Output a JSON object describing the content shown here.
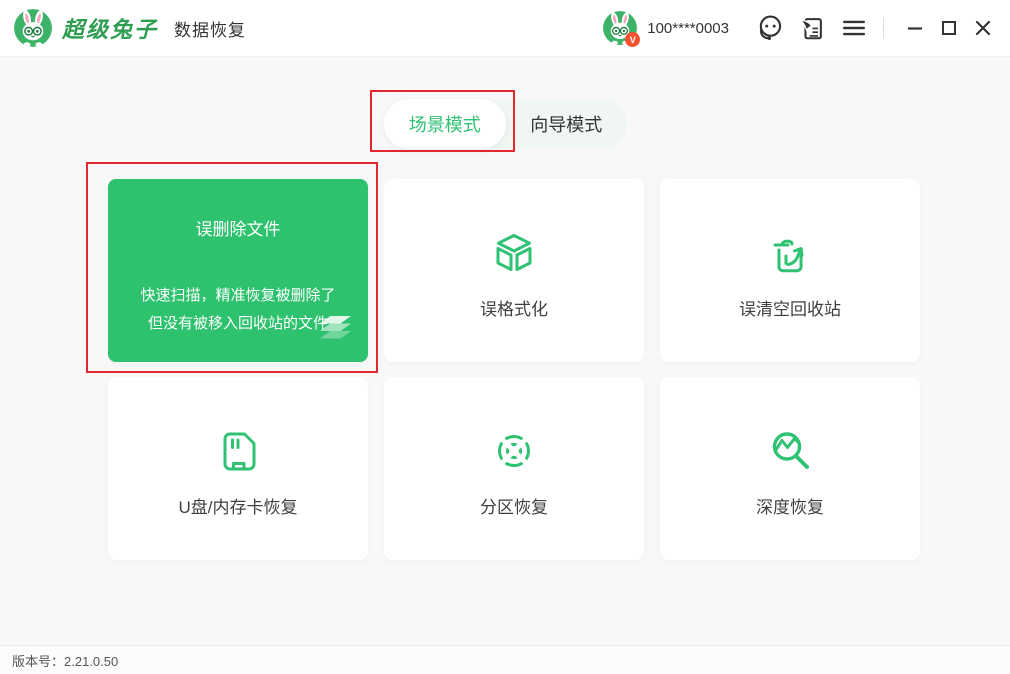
{
  "header": {
    "brand": "超级兔子",
    "product": "数据恢复",
    "account": "100****0003",
    "badge": "V"
  },
  "tabs": {
    "scene": {
      "label": "场景模式",
      "active": true
    },
    "wizard": {
      "label": "向导模式",
      "active": false
    }
  },
  "cards": {
    "featured": {
      "title": "误删除文件",
      "desc_line1": "快速扫描，精准恢复被删除了",
      "desc_line2": "但没有被移入回收站的文件"
    },
    "format": {
      "label": "误格式化"
    },
    "recycle": {
      "label": "误清空回收站"
    },
    "usb": {
      "label": "U盘/内存卡恢复"
    },
    "partition": {
      "label": "分区恢复"
    },
    "deep": {
      "label": "深度恢复"
    }
  },
  "footer": {
    "version": "版本号：2.21.0.50"
  },
  "colors": {
    "accent_green": "#2EC272",
    "featured_card_green": "#2EC26E",
    "logo_green": "#3DB269",
    "annotation_red": "#E0282E",
    "badge_orange": "#F4512C",
    "page_background": "#F7F8F7"
  },
  "icons": {
    "brand_logo": "rabbit-logo-icon",
    "avatar": "rabbit-avatar-icon",
    "customer_service": "headset-icon",
    "feedback": "feedback-note-icon",
    "menu": "hamburger-menu-icon",
    "minimize": "minimize-icon",
    "maximize": "maximize-icon",
    "close": "close-icon",
    "featured_corner": "layers-icon",
    "format_card": "cube-icon",
    "recycle_card": "trash-restore-icon",
    "usb_card": "sd-card-icon",
    "partition_card": "partition-ring-icon",
    "deep_card": "magnifier-chart-icon"
  }
}
